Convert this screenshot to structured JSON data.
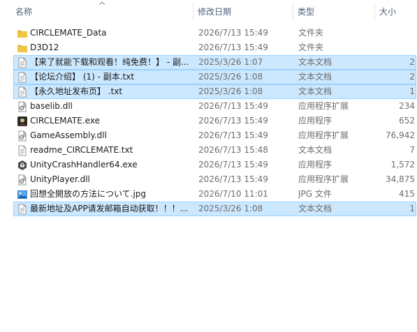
{
  "columns": {
    "name": "名称",
    "date": "修改日期",
    "type": "类型",
    "size": "大小"
  },
  "sort": {
    "column": "name",
    "direction": "ascending"
  },
  "colors": {
    "selection_bg": "#cce8ff",
    "selection_border": "#99d1ff",
    "folder": "#f3c545",
    "header_text": "#4c607a",
    "meta_text": "#6d6d6d"
  },
  "files": [
    {
      "name": "CIRCLEMATE_Data",
      "date": "2026/7/13 15:49",
      "type": "文件夹",
      "size": "",
      "icon": "folder-icon",
      "selected": false
    },
    {
      "name": "D3D12",
      "date": "2026/7/13 15:49",
      "type": "文件夹",
      "size": "",
      "icon": "folder-icon",
      "selected": false
    },
    {
      "name": "【来了就能下载和观看！纯免费！】 - 副...",
      "date": "2025/3/26 1:07",
      "type": "文本文档",
      "size": "2",
      "icon": "text-file-icon",
      "selected": true
    },
    {
      "name": "【论坛介绍】 (1) - 副本.txt",
      "date": "2025/3/26 1:08",
      "type": "文本文档",
      "size": "2",
      "icon": "text-file-icon",
      "selected": true
    },
    {
      "name": "【永久地址发布页】 .txt",
      "date": "2025/3/26 1:08",
      "type": "文本文档",
      "size": "1",
      "icon": "text-file-icon",
      "selected": true
    },
    {
      "name": "baselib.dll",
      "date": "2026/7/13 15:49",
      "type": "应用程序扩展",
      "size": "234",
      "icon": "dll-file-icon",
      "selected": false
    },
    {
      "name": "CIRCLEMATE.exe",
      "date": "2026/7/13 15:49",
      "type": "应用程序",
      "size": "652",
      "icon": "app-exe-icon",
      "selected": false
    },
    {
      "name": "GameAssembly.dll",
      "date": "2026/7/13 15:49",
      "type": "应用程序扩展",
      "size": "76,942",
      "icon": "dll-file-icon",
      "selected": false
    },
    {
      "name": "readme_CIRCLEMATE.txt",
      "date": "2026/7/13 15:48",
      "type": "文本文档",
      "size": "7",
      "icon": "text-file-icon",
      "selected": false
    },
    {
      "name": "UnityCrashHandler64.exe",
      "date": "2026/7/13 15:49",
      "type": "应用程序",
      "size": "1,572",
      "icon": "unity-exe-icon",
      "selected": false
    },
    {
      "name": "UnityPlayer.dll",
      "date": "2026/7/13 15:49",
      "type": "应用程序扩展",
      "size": "34,875",
      "icon": "dll-file-icon",
      "selected": false
    },
    {
      "name": "回想全開放の方法について.jpg",
      "date": "2026/7/10 11:01",
      "type": "JPG 文件",
      "size": "415",
      "icon": "image-file-icon",
      "selected": false
    },
    {
      "name": "最新地址及APP请发邮箱自动获取！！！...",
      "date": "2025/3/26 1:08",
      "type": "文本文档",
      "size": "1",
      "icon": "text-file-icon",
      "selected": true
    }
  ]
}
